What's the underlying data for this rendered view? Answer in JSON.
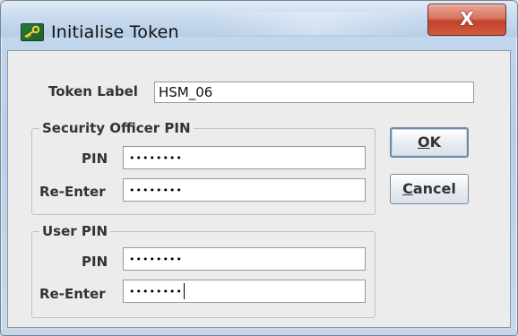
{
  "window": {
    "title": "Initialise Token",
    "close_label": "X"
  },
  "form": {
    "token_label_caption": "Token Label",
    "token_label_value": "HSM_06",
    "so_group_title": "Security Officer PIN",
    "so_pin_caption": "PIN",
    "so_pin_value": "••••••••",
    "so_reenter_caption": "Re-Enter",
    "so_reenter_value": "••••••••",
    "user_group_title": "User PIN",
    "user_pin_caption": "PIN",
    "user_pin_value": "••••••••",
    "user_reenter_caption": "Re-Enter",
    "user_reenter_value": "••••••••"
  },
  "buttons": {
    "ok_mnemonic": "O",
    "ok_rest": "K",
    "cancel_mnemonic": "C",
    "cancel_rest": "ancel"
  },
  "colors": {
    "title_bar": "#c9dbef",
    "close_button": "#c2422b",
    "dialog_body": "#ececec"
  },
  "icons": {
    "app": "key-icon",
    "close": "close-icon"
  }
}
